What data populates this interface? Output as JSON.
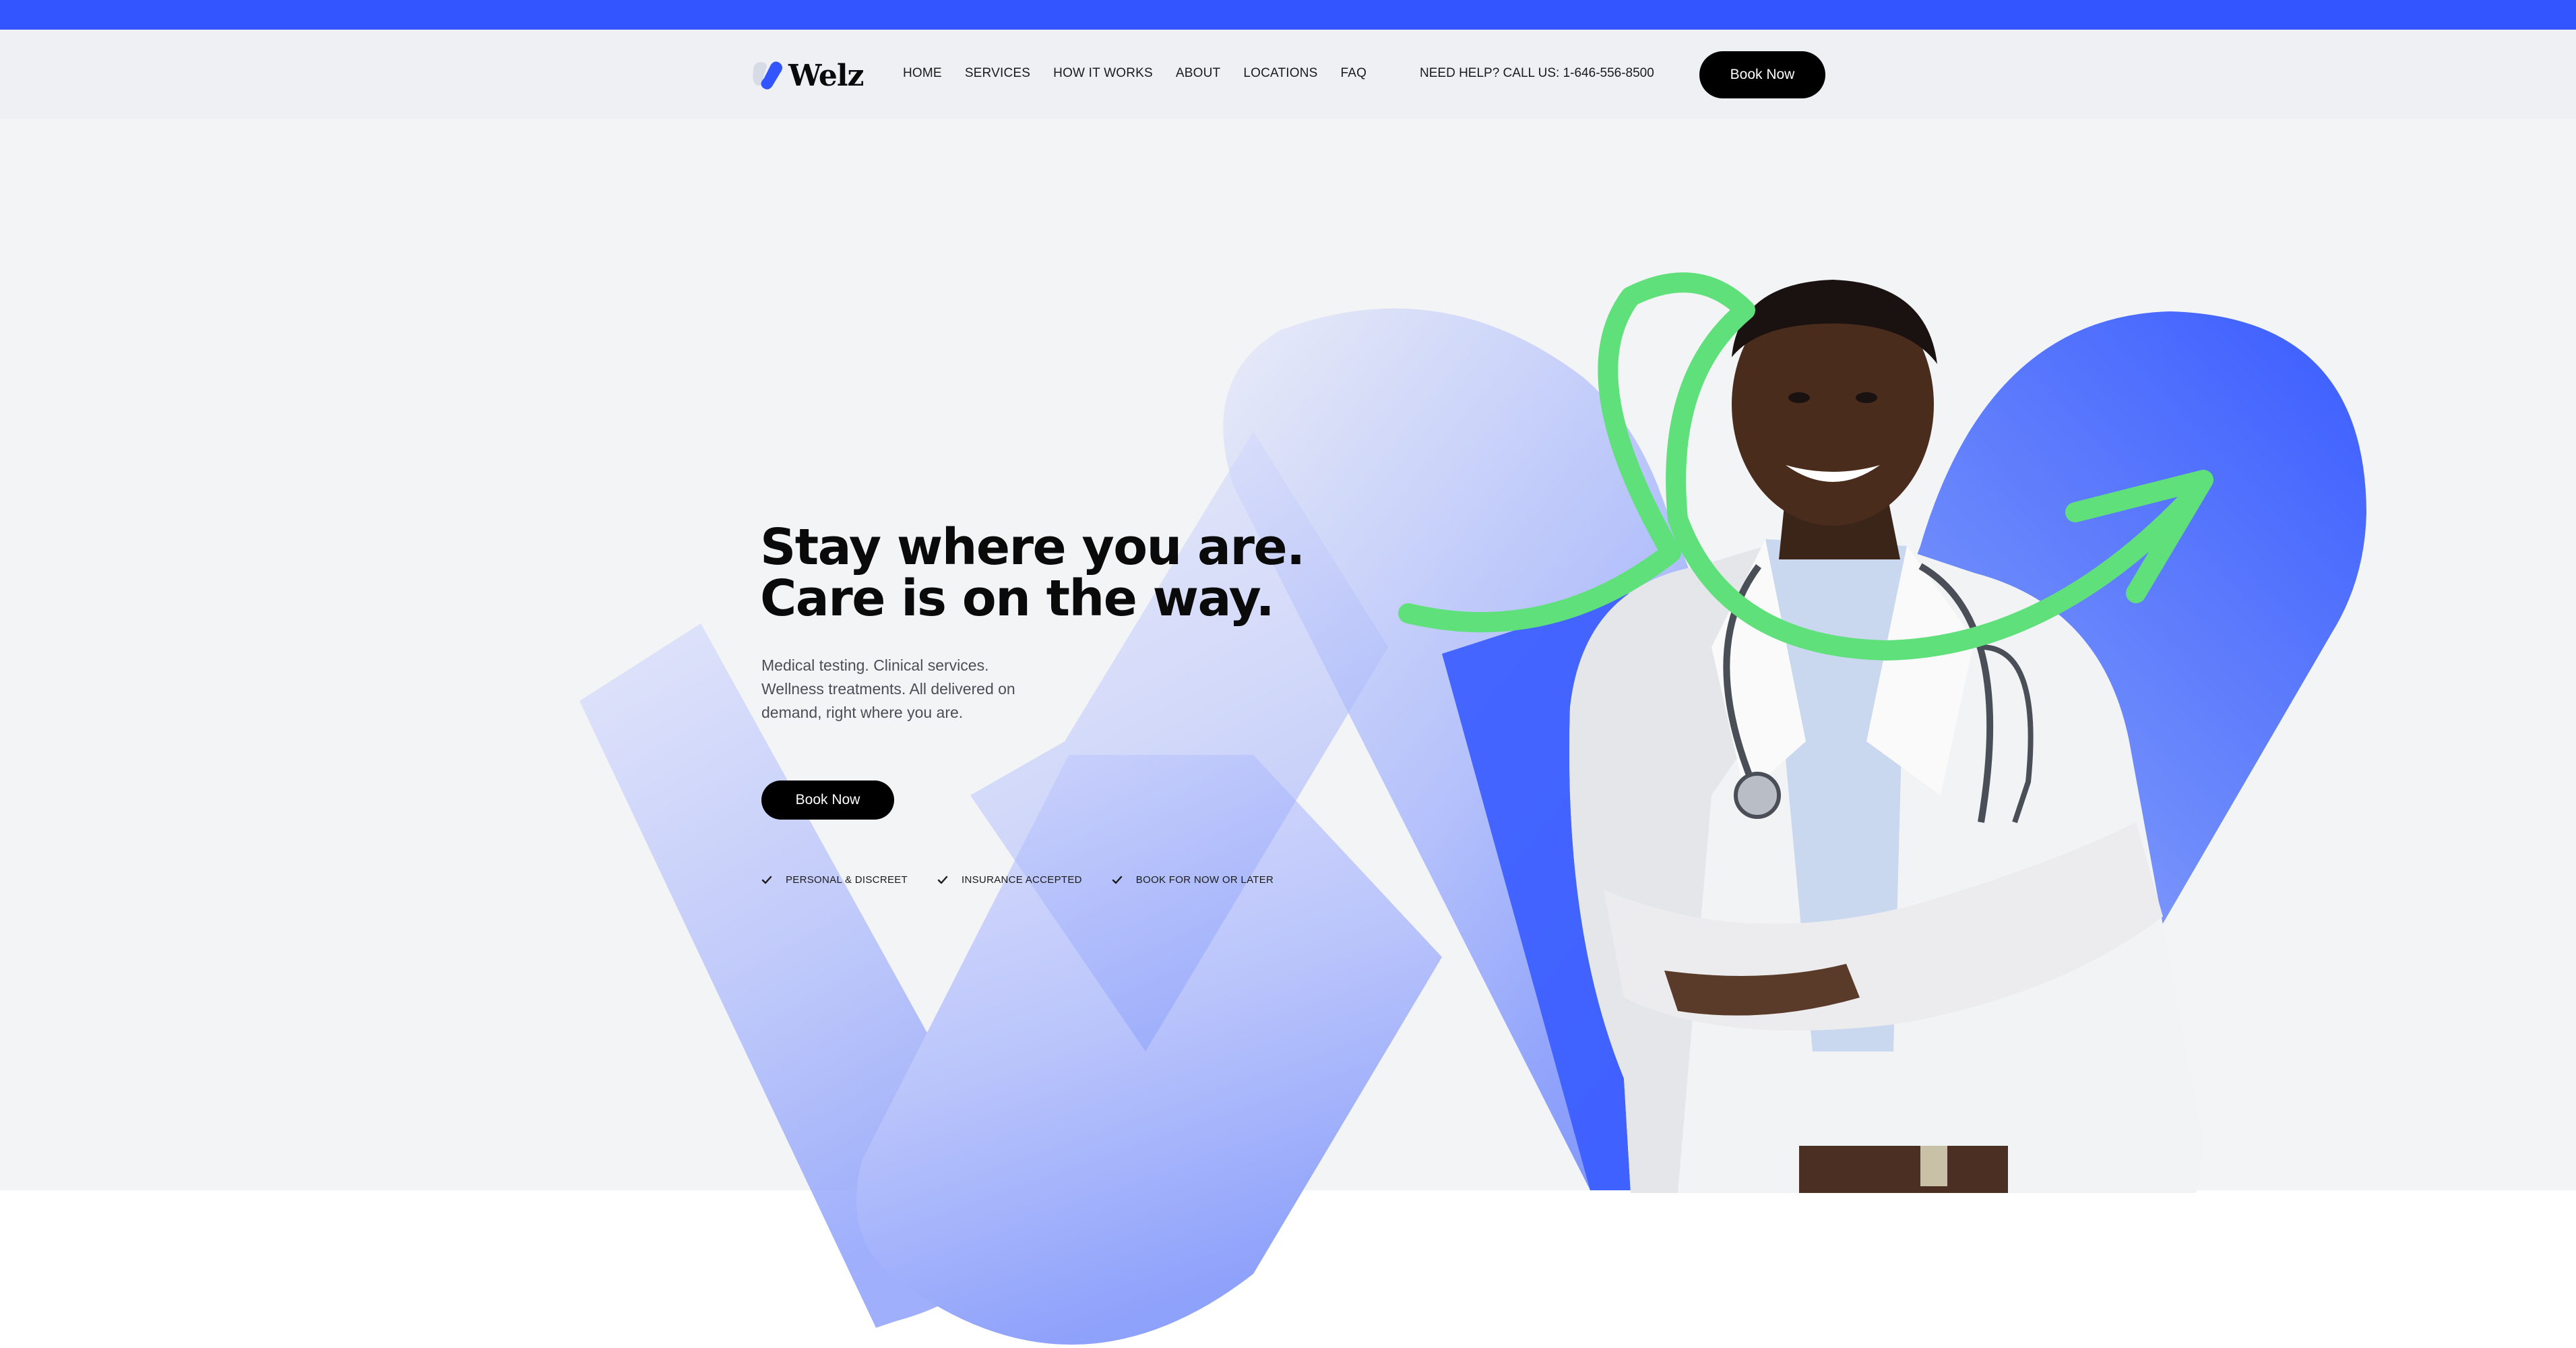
{
  "brand": {
    "name": "Welz",
    "accent": "#3355ff",
    "green": "#5fe07a"
  },
  "nav": {
    "items": [
      "HOME",
      "SERVICES",
      "HOW IT WORKS",
      "ABOUT",
      "LOCATIONS",
      "FAQ"
    ],
    "help": "NEED HELP? CALL US: 1-646-556-8500",
    "cta": "Book Now"
  },
  "hero": {
    "headline_line1": "Stay where you are.",
    "headline_line2": "Care is on the way.",
    "subtext": "Medical testing. Clinical services. Wellness treatments. All delivered on demand, right where you are.",
    "cta": "Book Now",
    "features": [
      "PERSONAL & DISCREET",
      "INSURANCE ACCEPTED",
      "BOOK FOR NOW OR LATER"
    ],
    "image": "smiling-doctor-photo"
  },
  "icons": [
    "logo-mark-icon",
    "check-icon",
    "arrow-swoosh-icon"
  ]
}
